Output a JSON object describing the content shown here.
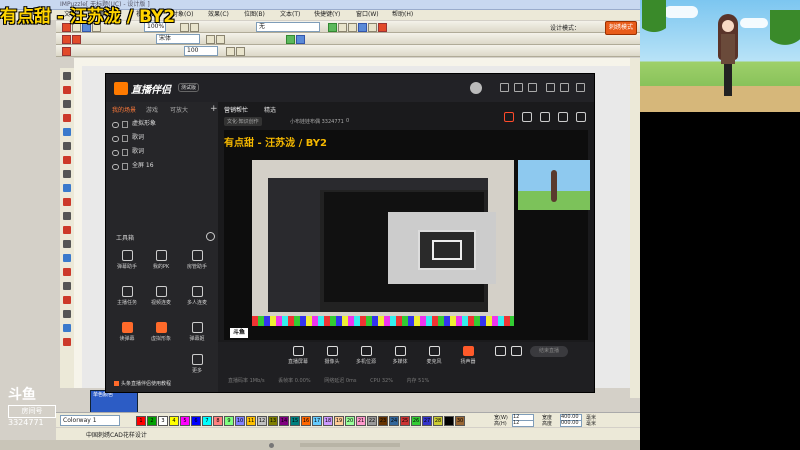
{
  "stream_title": "有点甜 - 汪苏泷 / BY2",
  "host": {
    "title": "IMPuzzle[ 无标题(UC) - 设计版 ]",
    "menu": [
      "文件(F)",
      "编辑(E)",
      "视图(V)",
      "对象(O)",
      "效果(C)",
      "位图(B)",
      "文本(T)",
      "快捷键(Y)",
      "窗口(W)",
      "帮助(H)"
    ],
    "combo_scale": "100%",
    "combo_text": "无",
    "combo_font": "宋体",
    "combo_size": "100",
    "design_mode_label": "设计模式：",
    "design_mode_button": "刺绣模式",
    "palette_select": "Colorway 1",
    "swatches": [
      "1",
      "2",
      "3",
      "4",
      "5",
      "6",
      "7",
      "8",
      "9",
      "10",
      "11",
      "12",
      "13",
      "14",
      "15",
      "16",
      "17",
      "18",
      "19",
      "20",
      "21",
      "22",
      "23",
      "24",
      "25",
      "26",
      "27",
      "28",
      "29",
      "30"
    ],
    "swatch_colors": [
      "#ff0000",
      "#00a000",
      "#ffffff",
      "#ffff00",
      "#ff00ff",
      "#0000ff",
      "#00ffff",
      "#ff8080",
      "#80ff80",
      "#8080ff",
      "#ffc000",
      "#c0c0c0",
      "#808000",
      "#800080",
      "#008080",
      "#ff6600",
      "#66ccff",
      "#cc99ff",
      "#ffcc99",
      "#99ff99",
      "#ff99cc",
      "#999999",
      "#663300",
      "#336699",
      "#cc3333",
      "#33cc33",
      "#3333cc",
      "#cccc33",
      "#000000",
      "#996633"
    ],
    "size_fields": {
      "l1": "宽(W)",
      "v1": "12",
      "l2": "高(H)",
      "v2": "12",
      "l3": "宽度",
      "v3": "400.00",
      "l4": "高度",
      "v4": "000.00",
      "l5": "毫米",
      "l6": "毫米"
    },
    "props_panel": "单色颜色",
    "status": "中国刺绣CAD花样设计"
  },
  "companion": {
    "name": "直播伴侣",
    "beta": "测试版",
    "scene_tabs": [
      "我的场景",
      "游戏",
      "可放大"
    ],
    "sources": [
      {
        "label": "虚拟形象"
      },
      {
        "label": "歌词"
      },
      {
        "label": "歌词"
      },
      {
        "label": "全屏 16"
      }
    ],
    "toolbox_label": "工具箱",
    "tools": [
      {
        "label": "弹幕助手"
      },
      {
        "label": "我的PK"
      },
      {
        "label": "房管助手"
      },
      {
        "label": "主播任务"
      },
      {
        "label": "视频连麦"
      },
      {
        "label": "多人连麦"
      },
      {
        "label": "读弹幕"
      },
      {
        "label": "虚拟形象"
      },
      {
        "label": "弹幕姬"
      },
      {
        "label": "更多"
      }
    ],
    "tip": "头条直播伴侣使用教程",
    "main_tabs": [
      "营销帮忙",
      "精选"
    ],
    "room_category": "文化·知识创作",
    "room_title": "小布娃娃布偶 3324771",
    "room_likes": "0",
    "preview_caption": "有点甜 - 汪苏泷 / BY2",
    "brand_mark": "斗鱼",
    "bottom_tools": [
      {
        "label": "直播屏幕"
      },
      {
        "label": "摄像头"
      },
      {
        "label": "多机位源"
      },
      {
        "label": "多媒体"
      },
      {
        "label": "麦克风"
      },
      {
        "label": "扬声器"
      }
    ],
    "go_live": "结束直播",
    "stats": [
      "直播码率 1Mb/s",
      "丢帧率 0.00%",
      "网络延迟 0ms",
      "CPU 32%",
      "内存 51%"
    ]
  },
  "room_badge": {
    "logo": "斗鱼",
    "label": "房间号",
    "number": "3324771"
  }
}
